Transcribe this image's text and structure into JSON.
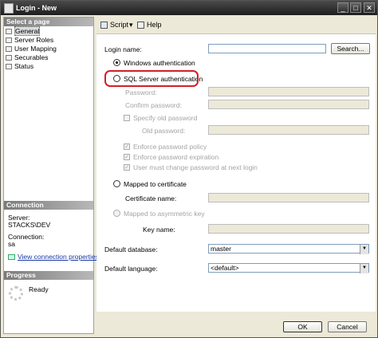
{
  "window": {
    "title": "Login - New",
    "min": "_",
    "max": "□",
    "close": "✕"
  },
  "left": {
    "select_header": "Select a page",
    "pages": [
      "General",
      "Server Roles",
      "User Mapping",
      "Securables",
      "Status"
    ],
    "connection_header": "Connection",
    "server_label": "Server:",
    "server_value": "STACKS\\DEV",
    "connection_label": "Connection:",
    "connection_value": "sa",
    "view_link": "View connection properties",
    "progress_header": "Progress",
    "progress_status": "Ready"
  },
  "toolbar": {
    "script": "Script",
    "script_arrow": "▾",
    "help": "Help"
  },
  "form": {
    "login_name_label": "Login name:",
    "login_name_value": "",
    "search_button": "Search...",
    "windows_auth": "Windows authentication",
    "sql_auth": "SQL Server authentication",
    "password_label": "Password:",
    "confirm_label": "Confirm password:",
    "specify_old": "Specify old password",
    "old_password_label": "Old password:",
    "enforce_policy": "Enforce password policy",
    "enforce_expiration": "Enforce password expiration",
    "must_change": "User must change password at next login",
    "mapped_cert": "Mapped to certificate",
    "cert_name_label": "Certificate name:",
    "mapped_asym": "Mapped to asymmetric key",
    "key_name_label": "Key name:",
    "default_db_label": "Default database:",
    "default_db_value": "master",
    "default_lang_label": "Default language:",
    "default_lang_value": "<default>"
  },
  "footer": {
    "ok": "OK",
    "cancel": "Cancel"
  },
  "colors": {
    "highlight": "#d0202a",
    "link": "#1a3aa6"
  }
}
